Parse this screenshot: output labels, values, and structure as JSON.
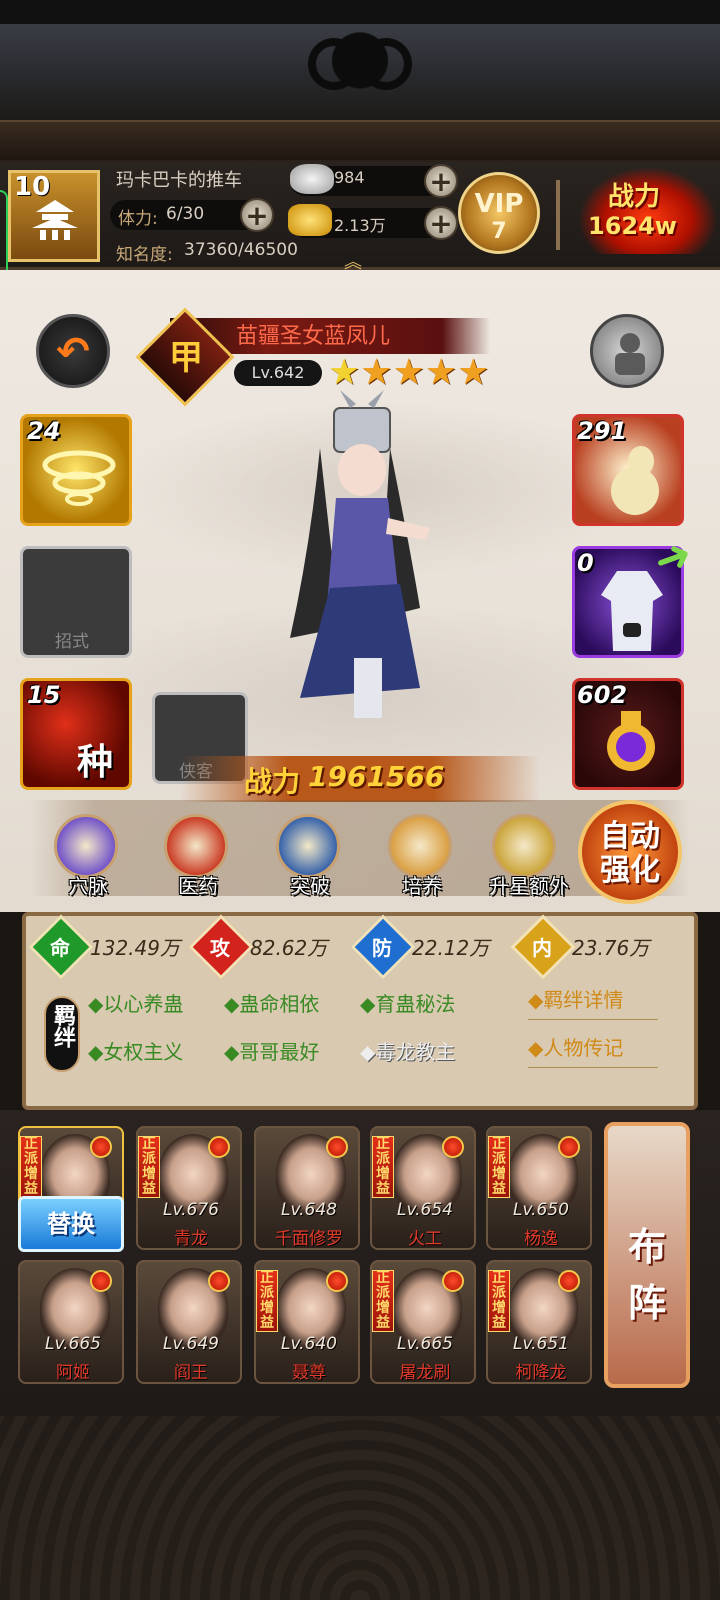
{
  "header": {
    "player_level": "10",
    "player_name": "玛卡巴卡的推车",
    "stamina_label": "体力:",
    "stamina_value": "6/30",
    "fame_label": "知名度:",
    "fame_value": "37360/46500",
    "silver": "984",
    "gold": "2.13万",
    "plus_symbol": "+",
    "vip_label": "VIP",
    "vip_level": "7",
    "power_label": "战力",
    "power_value": "1624w"
  },
  "character": {
    "title": "苗疆圣女蓝凤儿",
    "rank_char": "甲",
    "level": "Lv.642",
    "stars": 5,
    "power_label": "战力",
    "power_value": "1961566"
  },
  "slots": {
    "left_top_count": "24",
    "left_mid_label": "招式",
    "left_bottom_count": "15",
    "left_bottom_char": "种",
    "retainer_label": "侠客",
    "right_top_count": "291",
    "right_mid_count": "0",
    "right_bottom_count": "602"
  },
  "actions": [
    {
      "label": "穴脉"
    },
    {
      "label": "医药"
    },
    {
      "label": "突破"
    },
    {
      "label": "培养"
    },
    {
      "label": "升星额外"
    }
  ],
  "auto_button": {
    "line1": "自动",
    "line2": "强化"
  },
  "attributes": [
    {
      "char": "命",
      "value": "132.49万",
      "color": "#1f9a2a"
    },
    {
      "char": "攻",
      "value": "82.62万",
      "color": "#d2231c"
    },
    {
      "char": "防",
      "value": "22.12万",
      "color": "#1f6fd0"
    },
    {
      "char": "内",
      "value": "23.76万",
      "color": "#d8a21a"
    }
  ],
  "bond_badge": "羁绊",
  "bonds": [
    {
      "label": "以心养蛊",
      "active": true
    },
    {
      "label": "蛊命相依",
      "active": true
    },
    {
      "label": "育蛊秘法",
      "active": true
    },
    {
      "label": "女权主义",
      "active": true
    },
    {
      "label": "哥哥最好",
      "active": true
    },
    {
      "label": "毒龙教主",
      "active": false
    }
  ],
  "links": {
    "bond_detail": "羁绊详情",
    "biography": "人物传记"
  },
  "team": {
    "replace_label": "替换",
    "formation_line1": "布",
    "formation_line2": "阵",
    "tag_text": "正派增益",
    "heroes": [
      {
        "level": "",
        "name": "",
        "tag": true
      },
      {
        "level": "Lv.676",
        "name": "青龙",
        "tag": true
      },
      {
        "level": "Lv.648",
        "name": "千面修罗",
        "tag": false
      },
      {
        "level": "Lv.654",
        "name": "火工",
        "tag": true
      },
      {
        "level": "Lv.650",
        "name": "杨逸",
        "tag": true
      },
      {
        "level": "Lv.665",
        "name": "阿姬",
        "tag": false
      },
      {
        "level": "Lv.649",
        "name": "阎王",
        "tag": false
      },
      {
        "level": "Lv.640",
        "name": "聂尊",
        "tag": true
      },
      {
        "level": "Lv.665",
        "name": "屠龙刷",
        "tag": true
      },
      {
        "level": "Lv.651",
        "name": "柯降龙",
        "tag": true
      }
    ]
  },
  "colors": {
    "gold": "#e6a21a",
    "red": "#d2231c",
    "panel": "#d8c9b0"
  }
}
